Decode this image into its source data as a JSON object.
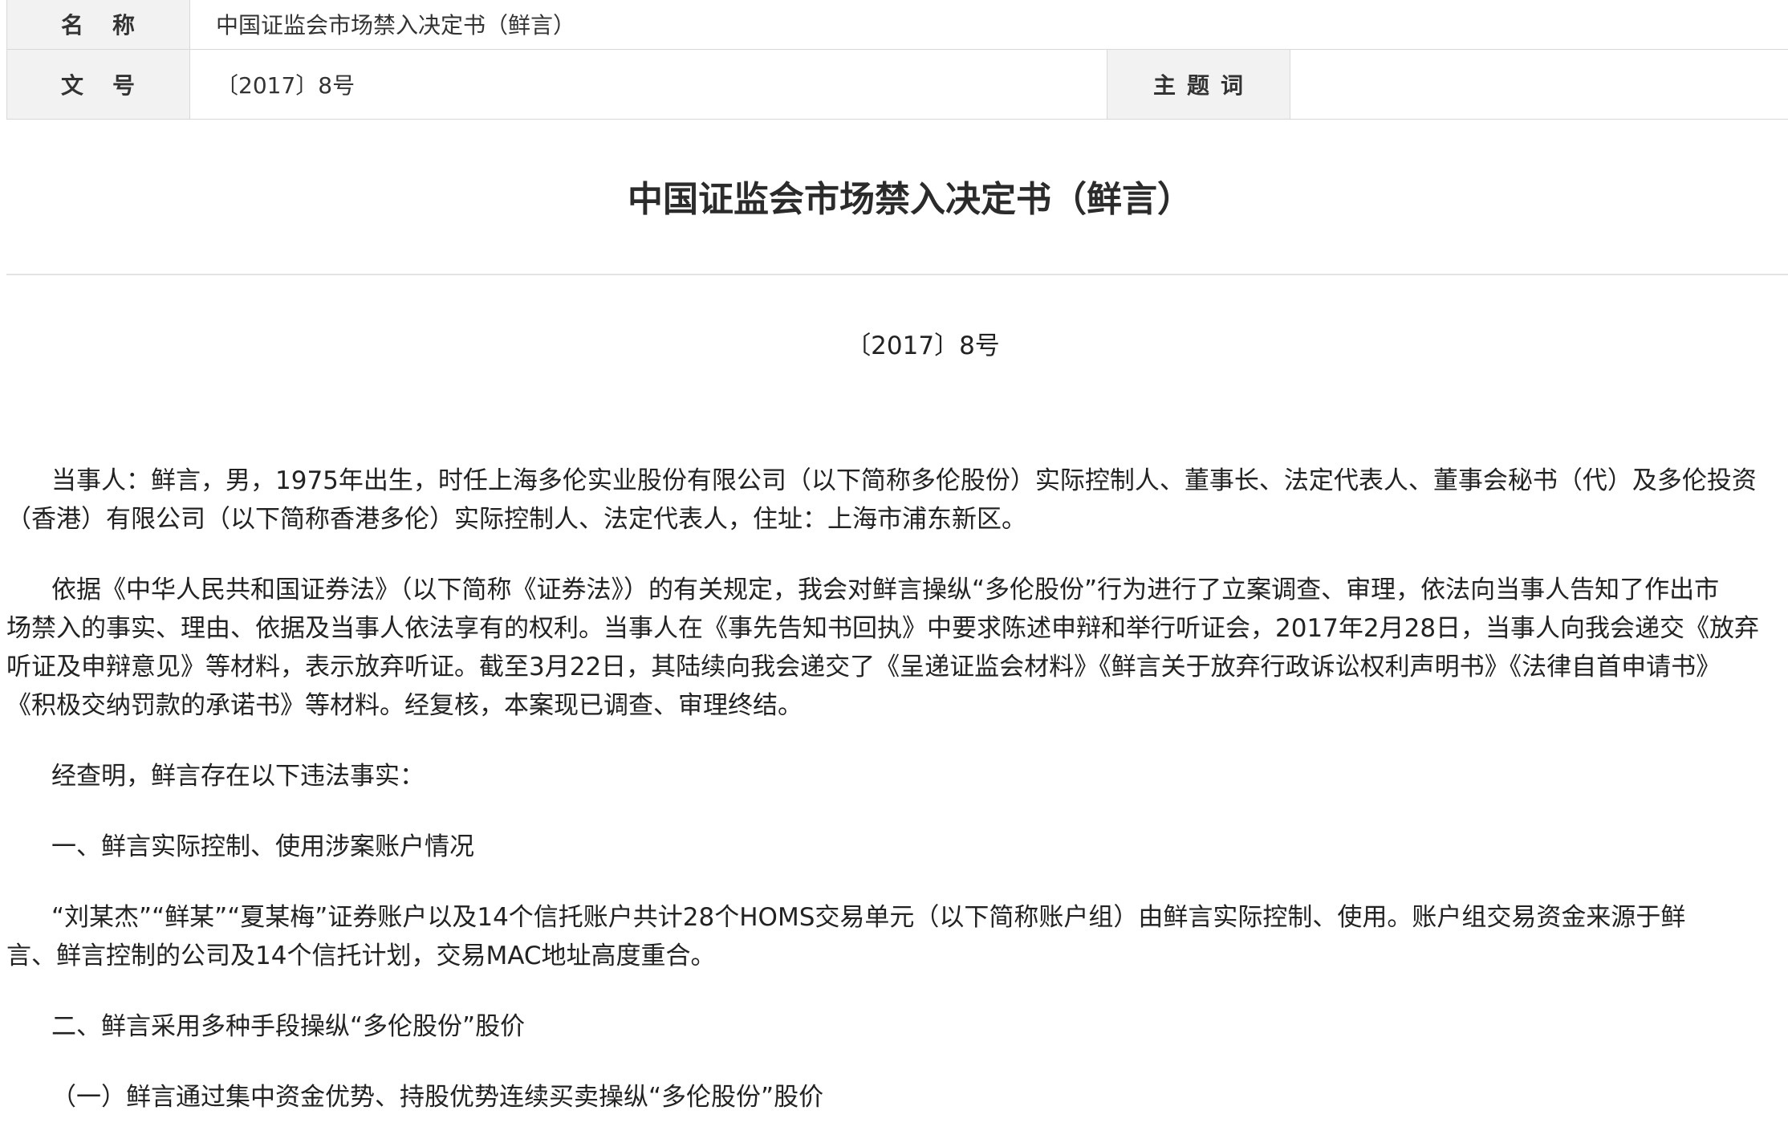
{
  "meta": {
    "name_label": "名称",
    "name_value": "中国证监会市场禁入决定书（鲜言）",
    "docno_label": "文号",
    "docno_value": "〔2017〕8号",
    "keyword_label": "主题词",
    "keyword_value": ""
  },
  "document": {
    "title": "中国证监会市场禁入决定书（鲜言）",
    "number": "〔2017〕8号",
    "paragraphs": [
      {
        "lines": [
          "当事人：鲜言，男，1975年出生，时任上海多伦实业股份有限公司（以下简称多伦股份）实际控制人、董事长、法定代表人、董事会秘书（代）及多伦投资",
          "（香港）有限公司（以下简称香港多伦）实际控制人、法定代表人，住址：上海市浦东新区。"
        ]
      },
      {
        "lines": [
          "依据《中华人民共和国证券法》（以下简称《证券法》）的有关规定，我会对鲜言操纵“多伦股份”行为进行了立案调查、审理，依法向当事人告知了作出市",
          "场禁入的事实、理由、依据及当事人依法享有的权利。当事人在《事先告知书回执》中要求陈述申辩和举行听证会，2017年2月28日，当事人向我会递交《放弃",
          "听证及申辩意见》等材料，表示放弃听证。截至3月22日，其陆续向我会递交了《呈递证监会材料》《鲜言关于放弃行政诉讼权利声明书》《法律自首申请书》",
          "《积极交纳罚款的承诺书》等材料。经复核，本案现已调查、审理终结。"
        ]
      },
      {
        "lines": [
          "经查明，鲜言存在以下违法事实："
        ]
      },
      {
        "lines": [
          "一、鲜言实际控制、使用涉案账户情况"
        ]
      },
      {
        "lines": [
          "“刘某杰”“鲜某”“夏某梅”证券账户以及14个信托账户共计28个HOMS交易单元（以下简称账户组）由鲜言实际控制、使用。账户组交易资金来源于鲜",
          "言、鲜言控制的公司及14个信托计划，交易MAC地址高度重合。"
        ]
      },
      {
        "lines": [
          "二、鲜言采用多种手段操纵“多伦股份”股价"
        ]
      },
      {
        "lines": [
          "（一）鲜言通过集中资金优势、持股优势连续买卖操纵“多伦股份”股价"
        ]
      }
    ]
  }
}
